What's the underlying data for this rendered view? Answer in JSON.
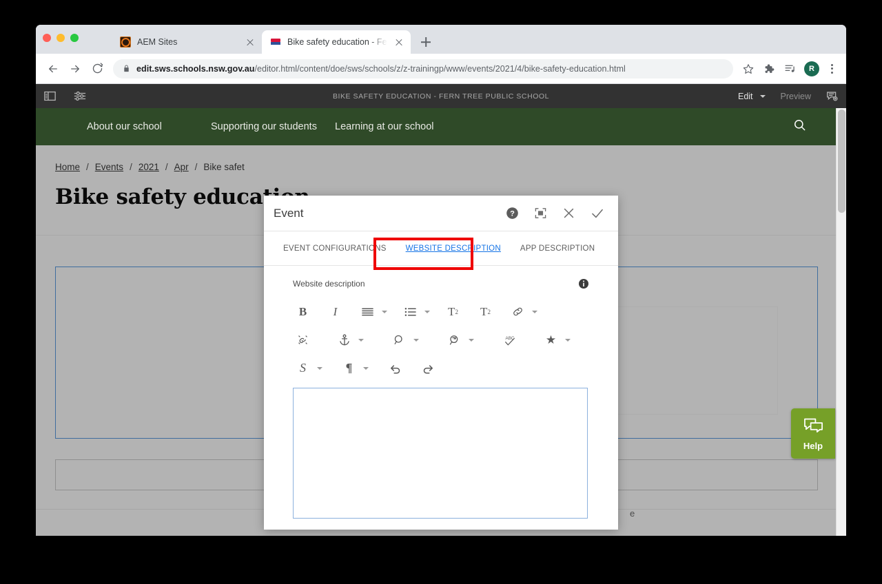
{
  "browser": {
    "tabs": [
      {
        "title": "AEM Sites",
        "favicon": "aem-icon",
        "active": false
      },
      {
        "title": "Bike safety education - Fern Tr",
        "favicon": "nsw-icon",
        "active": true
      }
    ],
    "new_tab_label": "+",
    "omnibox": {
      "url_bold": "edit.sws.schools.nsw.gov.au",
      "url_rest": "/editor.html/content/doe/sws/schools/z/z-trainingp/www/events/2021/4/bike-safety-education.html",
      "full_url": "edit.sws.schools.nsw.gov.au/editor.html/content/doe/sws/schools/z/z-trainingp/www/events/2021/4/bike-safety-education.html",
      "lock_icon": "lock-icon"
    },
    "toolbar_icons": {
      "back": "back-arrow-icon",
      "forward": "forward-arrow-icon",
      "reload": "reload-icon",
      "bookmark": "star-icon",
      "extensions": "puzzle-piece-icon",
      "media": "media-list-icon",
      "profile_initial": "R",
      "menu": "kebab-menu-icon"
    }
  },
  "aem_bar": {
    "rail_toggle_icon": "sidebar-panel-icon",
    "page_info_icon": "sliders-icon",
    "title": "BIKE SAFETY EDUCATION - FERN TREE PUBLIC SCHOOL",
    "edit_label": "Edit",
    "preview_label": "Preview",
    "annotations_icon": "annotations-icon"
  },
  "site_nav": {
    "items": [
      {
        "label": "About our school"
      },
      {
        "label": "Supporting our students"
      },
      {
        "label": "Learning at our school"
      }
    ],
    "search_icon": "search-icon",
    "background_color": "#2f4a28"
  },
  "page": {
    "breadcrumb": [
      {
        "label": "Home",
        "link": true
      },
      {
        "label": "Events",
        "link": true
      },
      {
        "label": "2021",
        "link": true
      },
      {
        "label": "Apr",
        "link": true
      },
      {
        "label": "Bike safet",
        "link": false
      }
    ],
    "breadcrumb_separator": "/",
    "title": "Bike safety education",
    "ghost_text": "e"
  },
  "help_tab": {
    "label": "Help",
    "icon": "chat-bubble-icon",
    "color": "#76a028"
  },
  "dialog": {
    "title": "Event",
    "actions": [
      {
        "name": "help-icon",
        "label": "?"
      },
      {
        "name": "fullscreen-icon",
        "label": ""
      },
      {
        "name": "close-icon",
        "label": ""
      },
      {
        "name": "confirm-check-icon",
        "label": ""
      }
    ],
    "tabs": [
      {
        "label": "EVENT CONFIGURATIONS",
        "active": false
      },
      {
        "label": "WEBSITE DESCRIPTION",
        "active": true
      },
      {
        "label": "APP DESCRIPTION",
        "active": false
      }
    ],
    "highlight_color": "#ef0000",
    "field": {
      "label": "Website description",
      "info_icon": "info-icon",
      "editor_value": "",
      "editor_placeholder": ""
    },
    "rte_toolbar": {
      "row1": [
        {
          "name": "bold-icon",
          "glyph": "B"
        },
        {
          "name": "italic-icon",
          "glyph": "I"
        },
        {
          "name": "align-icon",
          "glyph": "≡",
          "caret": true
        },
        {
          "name": "bullet-list-icon",
          "glyph": "☰",
          "caret": true
        },
        {
          "name": "subscript-icon",
          "glyph": "T₂"
        },
        {
          "name": "superscript-icon",
          "glyph": "T²"
        },
        {
          "name": "hyperlink-icon",
          "glyph": "🔗",
          "caret": true
        }
      ],
      "row2": [
        {
          "name": "unlink-icon",
          "glyph": ""
        },
        {
          "name": "anchor-icon",
          "glyph": "⚓",
          "caret": true
        },
        {
          "name": "find-icon",
          "glyph": "🔍",
          "caret": true
        },
        {
          "name": "find-replace-icon",
          "glyph": "",
          "caret": true
        },
        {
          "name": "spellcheck-icon",
          "glyph": "ABC"
        },
        {
          "name": "special-character-icon",
          "glyph": "★",
          "caret": true
        }
      ],
      "row3": [
        {
          "name": "text-style-icon",
          "glyph": "S",
          "caret": true
        },
        {
          "name": "paragraph-format-icon",
          "glyph": "¶",
          "caret": true
        },
        {
          "name": "undo-icon",
          "glyph": "↺"
        },
        {
          "name": "redo-icon",
          "glyph": "↻"
        }
      ]
    }
  }
}
